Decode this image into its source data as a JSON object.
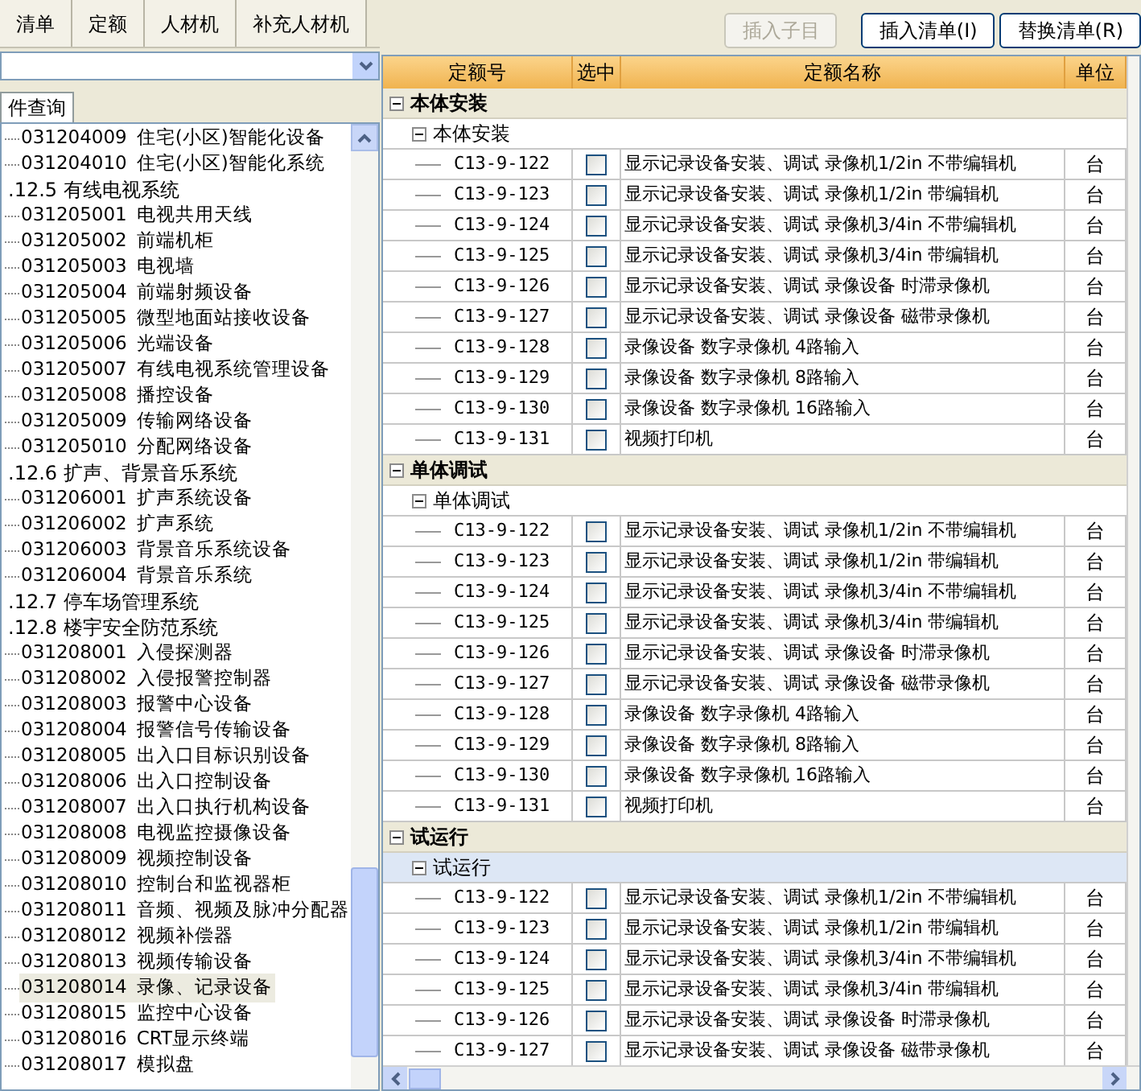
{
  "tabs": [
    {
      "label": "清单",
      "selected": false
    },
    {
      "label": "定额",
      "selected": false
    },
    {
      "label": "人材机",
      "selected": false
    },
    {
      "label": "补充人材机",
      "selected": false
    }
  ],
  "search_tab": {
    "label": "件查询"
  },
  "tree": [
    {
      "kind": "item",
      "code": "031204009",
      "name": "住宅(小区)智能化设备",
      "selected": false
    },
    {
      "kind": "item",
      "code": "031204010",
      "name": "住宅(小区)智能化系统",
      "selected": false
    },
    {
      "kind": "category",
      "name": ".12.5 有线电视系统",
      "children": [
        {
          "kind": "item",
          "code": "031205001",
          "name": "电视共用天线",
          "selected": false
        },
        {
          "kind": "item",
          "code": "031205002",
          "name": "前端机柜",
          "selected": false
        },
        {
          "kind": "item",
          "code": "031205003",
          "name": "电视墙",
          "selected": false
        },
        {
          "kind": "item",
          "code": "031205004",
          "name": "前端射频设备",
          "selected": false
        },
        {
          "kind": "item",
          "code": "031205005",
          "name": "微型地面站接收设备",
          "selected": false
        },
        {
          "kind": "item",
          "code": "031205006",
          "name": "光端设备",
          "selected": false
        },
        {
          "kind": "item",
          "code": "031205007",
          "name": "有线电视系统管理设备",
          "selected": false
        },
        {
          "kind": "item",
          "code": "031205008",
          "name": "播控设备",
          "selected": false
        },
        {
          "kind": "item",
          "code": "031205009",
          "name": "传输网络设备",
          "selected": false
        },
        {
          "kind": "item",
          "code": "031205010",
          "name": "分配网络设备",
          "selected": false
        }
      ]
    },
    {
      "kind": "category",
      "name": ".12.6 扩声、背景音乐系统",
      "children": [
        {
          "kind": "item",
          "code": "031206001",
          "name": "扩声系统设备",
          "selected": false
        },
        {
          "kind": "item",
          "code": "031206002",
          "name": "扩声系统",
          "selected": false
        },
        {
          "kind": "item",
          "code": "031206003",
          "name": "背景音乐系统设备",
          "selected": false
        },
        {
          "kind": "item",
          "code": "031206004",
          "name": "背景音乐系统",
          "selected": false
        }
      ]
    },
    {
      "kind": "category",
      "name": ".12.7 停车场管理系统"
    },
    {
      "kind": "category",
      "name": ".12.8 楼宇安全防范系统",
      "children": [
        {
          "kind": "item",
          "code": "031208001",
          "name": "入侵探测器",
          "selected": false
        },
        {
          "kind": "item",
          "code": "031208002",
          "name": "入侵报警控制器",
          "selected": false
        },
        {
          "kind": "item",
          "code": "031208003",
          "name": "报警中心设备",
          "selected": false
        },
        {
          "kind": "item",
          "code": "031208004",
          "name": "报警信号传输设备",
          "selected": false
        },
        {
          "kind": "item",
          "code": "031208005",
          "name": "出入口目标识别设备",
          "selected": false
        },
        {
          "kind": "item",
          "code": "031208006",
          "name": "出入口控制设备",
          "selected": false
        },
        {
          "kind": "item",
          "code": "031208007",
          "name": "出入口执行机构设备",
          "selected": false
        },
        {
          "kind": "item",
          "code": "031208008",
          "name": "电视监控摄像设备",
          "selected": false
        },
        {
          "kind": "item",
          "code": "031208009",
          "name": "视频控制设备",
          "selected": false
        },
        {
          "kind": "item",
          "code": "031208010",
          "name": "控制台和监视器柜",
          "selected": false
        },
        {
          "kind": "item",
          "code": "031208011",
          "name": "音频、视频及脉冲分配器",
          "selected": false
        },
        {
          "kind": "item",
          "code": "031208012",
          "name": "视频补偿器",
          "selected": false
        },
        {
          "kind": "item",
          "code": "031208013",
          "name": "视频传输设备",
          "selected": false
        },
        {
          "kind": "item",
          "code": "031208014",
          "name": "录像、记录设备",
          "selected": true
        },
        {
          "kind": "item",
          "code": "031208015",
          "name": "监控中心设备",
          "selected": false
        },
        {
          "kind": "item",
          "code": "031208016",
          "name": "CRT显示终端",
          "selected": false
        },
        {
          "kind": "item",
          "code": "031208017",
          "name": "模拟盘",
          "selected": false
        }
      ]
    }
  ],
  "buttons": [
    {
      "label": "插入子目",
      "disabled": true
    },
    {
      "label": "插入清单(I)",
      "disabled": false
    },
    {
      "label": "替换清单(R)",
      "disabled": false
    }
  ],
  "columns": [
    "定额号",
    "选中",
    "定额名称",
    "单位"
  ],
  "groups": [
    {
      "name": "本体安装",
      "subgroups": [
        {
          "name": "本体安装",
          "selected": false,
          "rows": [
            {
              "code": "C13-9-122",
              "checked": false,
              "name": "显示记录设备安装、调试 录像机1/2in 不带编辑机",
              "unit": "台"
            },
            {
              "code": "C13-9-123",
              "checked": false,
              "name": "显示记录设备安装、调试 录像机1/2in 带编辑机",
              "unit": "台"
            },
            {
              "code": "C13-9-124",
              "checked": false,
              "name": "显示记录设备安装、调试 录像机3/4in 不带编辑机",
              "unit": "台"
            },
            {
              "code": "C13-9-125",
              "checked": false,
              "name": "显示记录设备安装、调试 录像机3/4in 带编辑机",
              "unit": "台"
            },
            {
              "code": "C13-9-126",
              "checked": false,
              "name": "显示记录设备安装、调试 录像设备 时滞录像机",
              "unit": "台"
            },
            {
              "code": "C13-9-127",
              "checked": false,
              "name": "显示记录设备安装、调试 录像设备 磁带录像机",
              "unit": "台"
            },
            {
              "code": "C13-9-128",
              "checked": false,
              "name": "录像设备 数字录像机 4路输入",
              "unit": "台"
            },
            {
              "code": "C13-9-129",
              "checked": false,
              "name": "录像设备 数字录像机 8路输入",
              "unit": "台"
            },
            {
              "code": "C13-9-130",
              "checked": false,
              "name": "录像设备 数字录像机 16路输入",
              "unit": "台"
            },
            {
              "code": "C13-9-131",
              "checked": false,
              "name": "视频打印机",
              "unit": "台"
            }
          ]
        }
      ]
    },
    {
      "name": "单体调试",
      "subgroups": [
        {
          "name": "单体调试",
          "selected": false,
          "rows": [
            {
              "code": "C13-9-122",
              "checked": false,
              "name": "显示记录设备安装、调试 录像机1/2in 不带编辑机",
              "unit": "台"
            },
            {
              "code": "C13-9-123",
              "checked": false,
              "name": "显示记录设备安装、调试 录像机1/2in 带编辑机",
              "unit": "台"
            },
            {
              "code": "C13-9-124",
              "checked": false,
              "name": "显示记录设备安装、调试 录像机3/4in 不带编辑机",
              "unit": "台"
            },
            {
              "code": "C13-9-125",
              "checked": false,
              "name": "显示记录设备安装、调试 录像机3/4in 带编辑机",
              "unit": "台"
            },
            {
              "code": "C13-9-126",
              "checked": false,
              "name": "显示记录设备安装、调试 录像设备 时滞录像机",
              "unit": "台"
            },
            {
              "code": "C13-9-127",
              "checked": false,
              "name": "显示记录设备安装、调试 录像设备 磁带录像机",
              "unit": "台"
            },
            {
              "code": "C13-9-128",
              "checked": false,
              "name": "录像设备 数字录像机 4路输入",
              "unit": "台"
            },
            {
              "code": "C13-9-129",
              "checked": false,
              "name": "录像设备 数字录像机 8路输入",
              "unit": "台"
            },
            {
              "code": "C13-9-130",
              "checked": false,
              "name": "录像设备 数字录像机 16路输入",
              "unit": "台"
            },
            {
              "code": "C13-9-131",
              "checked": false,
              "name": "视频打印机",
              "unit": "台"
            }
          ]
        }
      ]
    },
    {
      "name": "试运行",
      "subgroups": [
        {
          "name": "试运行",
          "selected": true,
          "rows": [
            {
              "code": "C13-9-122",
              "checked": false,
              "name": "显示记录设备安装、调试 录像机1/2in 不带编辑机",
              "unit": "台"
            },
            {
              "code": "C13-9-123",
              "checked": false,
              "name": "显示记录设备安装、调试 录像机1/2in 带编辑机",
              "unit": "台"
            },
            {
              "code": "C13-9-124",
              "checked": false,
              "name": "显示记录设备安装、调试 录像机3/4in 不带编辑机",
              "unit": "台"
            },
            {
              "code": "C13-9-125",
              "checked": false,
              "name": "显示记录设备安装、调试 录像机3/4in 带编辑机",
              "unit": "台"
            },
            {
              "code": "C13-9-126",
              "checked": false,
              "name": "显示记录设备安装、调试 录像设备 时滞录像机",
              "unit": "台"
            },
            {
              "code": "C13-9-127",
              "checked": false,
              "name": "显示记录设备安装、调试 录像设备 磁带录像机",
              "unit": "台"
            }
          ]
        }
      ]
    }
  ]
}
